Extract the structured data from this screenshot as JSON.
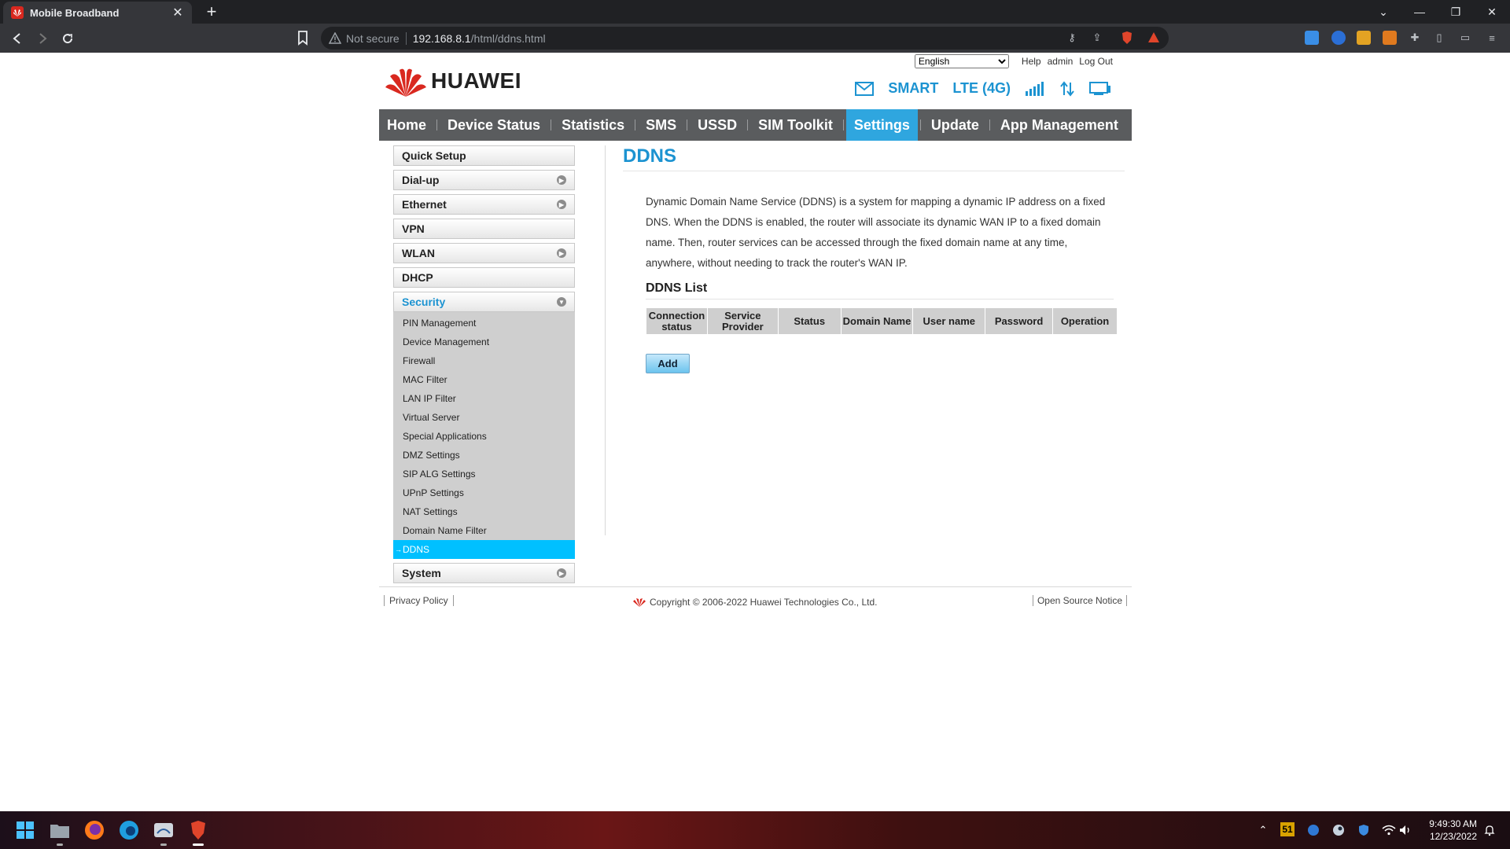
{
  "browser": {
    "tab_title": "Mobile Broadband",
    "not_secure": "Not secure",
    "url_host": "192.168.8.1",
    "url_path": "/html/ddns.html"
  },
  "header": {
    "brand": "HUAWEI",
    "language": "English",
    "links": {
      "help": "Help",
      "admin": "admin",
      "logout": "Log Out"
    },
    "status": {
      "operator": "SMART",
      "network": "LTE (4G)"
    }
  },
  "nav": {
    "items": [
      "Home",
      "Device Status",
      "Statistics",
      "SMS",
      "USSD",
      "SIM Toolkit",
      "Settings",
      "Update",
      "App Management"
    ],
    "active": "Settings"
  },
  "sidebar": {
    "items": [
      "Quick Setup",
      "Dial-up",
      "Ethernet",
      "VPN",
      "WLAN",
      "DHCP",
      "Security",
      "System"
    ],
    "security_sub": [
      "PIN Management",
      "Device Management",
      "Firewall",
      "MAC Filter",
      "LAN IP Filter",
      "Virtual Server",
      "Special Applications",
      "DMZ Settings",
      "SIP ALG Settings",
      "UPnP Settings",
      "NAT Settings",
      "Domain Name Filter",
      "DDNS"
    ],
    "active_sub": "DDNS"
  },
  "content": {
    "title": "DDNS",
    "description": "Dynamic Domain Name Service (DDNS) is a system for mapping a dynamic IP address on a fixed DNS. When the DDNS is enabled, the router will associate its dynamic WAN IP to a fixed domain name. Then, router services can be accessed through the fixed domain name at any time, anywhere, without needing to track the router's WAN IP.",
    "list_title": "DDNS List",
    "columns": [
      "Connection status",
      "Service Provider",
      "Status",
      "Domain Name",
      "User name",
      "Password",
      "Operation"
    ],
    "add_button": "Add"
  },
  "footer": {
    "privacy": "Privacy Policy",
    "copyright": "Copyright © 2006-2022 Huawei Technologies Co., Ltd.",
    "open_source": "Open Source Notice"
  },
  "taskbar": {
    "time": "9:49:30 AM",
    "date": "12/23/2022",
    "badge": "51"
  },
  "colors": {
    "accent": "#1c93d1",
    "nav_bg": "#5a5c5e",
    "nav_active": "#2fa6df",
    "sidebar_active": "#00c0ff",
    "huawei_red": "#d9281f"
  }
}
